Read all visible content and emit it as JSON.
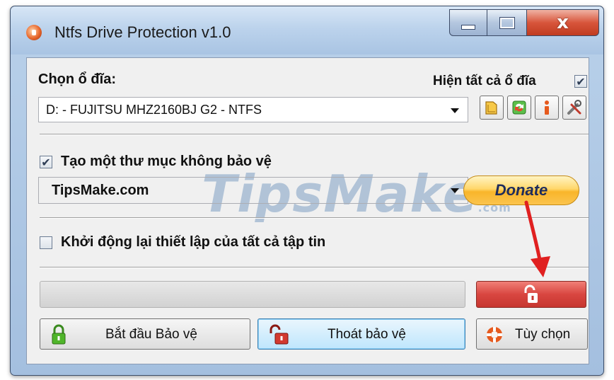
{
  "window": {
    "title": "Ntfs Drive Protection v1.0",
    "controls": {
      "close_glyph": "x"
    }
  },
  "drive": {
    "label": "Chọn ổ đĩa:",
    "show_all_label": "Hiện tất cả ổ đĩa",
    "show_all_checked": true,
    "selected": "D: - FUJITSU MHZ2160BJ G2 - NTFS",
    "icon_buttons": [
      "folder-icon",
      "refresh-icon",
      "info-icon",
      "tools-icon"
    ]
  },
  "unprotected_folder": {
    "checkbox_label": "Tạo một thư mục không bảo vệ",
    "checked": true,
    "selected": "TipsMake.com"
  },
  "donate": {
    "label": "Donate"
  },
  "watermark": {
    "text": "TipsMake",
    "suffix": ".com"
  },
  "restart": {
    "checkbox_label": "Khởi động lại thiết lập của tất cả tập tin",
    "checked": false
  },
  "progress": {
    "value": 0
  },
  "buttons": {
    "start_protect": "Bắt đầu Bảo vệ",
    "stop_protect": "Thoát bảo vệ",
    "options": "Tùy chọn"
  },
  "colors": {
    "title_gradient": "#bcd3ec",
    "close_button": "#d8553b",
    "lock_button": "#d94640",
    "donate_gold": "#ffd76a",
    "annotation_arrow": "#e02020"
  }
}
